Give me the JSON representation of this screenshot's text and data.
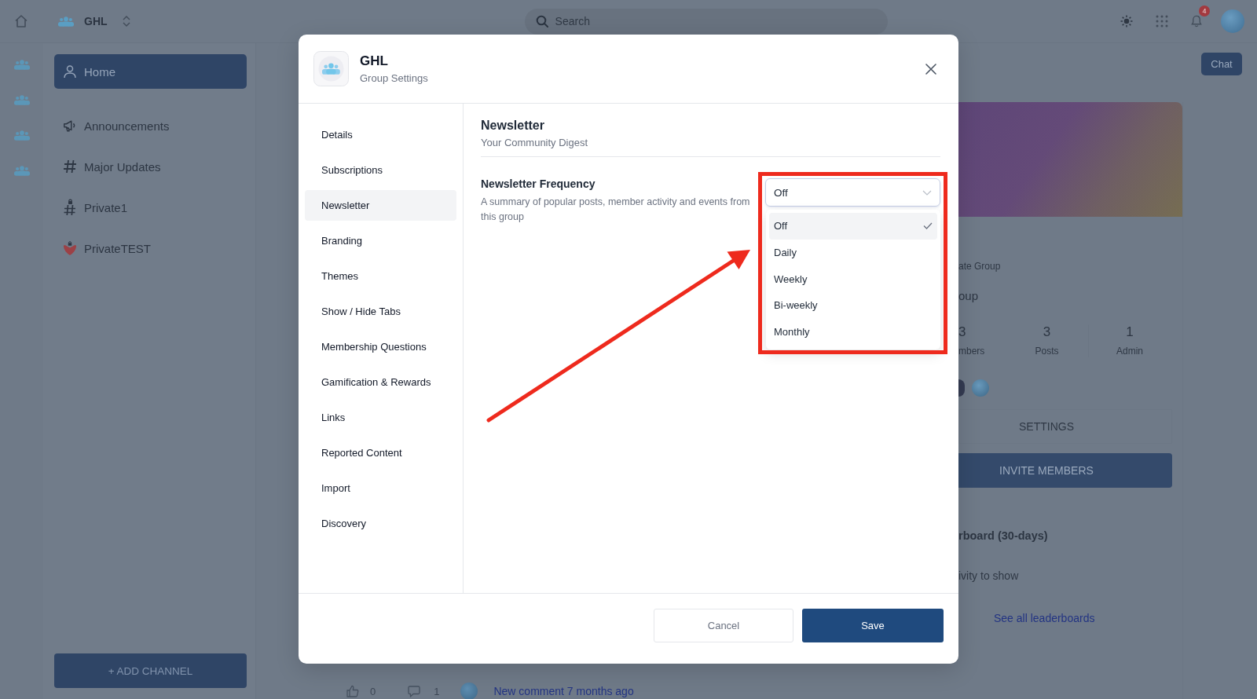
{
  "top_bar": {
    "group_name": "GHL",
    "search": {
      "placeholder": "Search"
    },
    "notification_count": "4"
  },
  "sidebar": {
    "items": [
      {
        "label": "Home",
        "kind": "home",
        "selected": true
      },
      {
        "label": "Announcements",
        "kind": "announcement",
        "selected": false
      },
      {
        "label": "Major Updates",
        "kind": "channel",
        "selected": false
      },
      {
        "label": "Private1",
        "kind": "private_channel",
        "selected": false
      },
      {
        "label": "PrivateTEST",
        "kind": "private_emoji",
        "selected": false
      }
    ],
    "add_button": "+ ADD CHANNEL"
  },
  "modal": {
    "title": "GHL",
    "subtitle": "Group Settings",
    "nav": [
      {
        "label": "Details",
        "selected": false
      },
      {
        "label": "Subscriptions",
        "selected": false
      },
      {
        "label": "Newsletter",
        "selected": true
      },
      {
        "label": "Branding",
        "selected": false
      },
      {
        "label": "Themes",
        "selected": false
      },
      {
        "label": "Show / Hide Tabs",
        "selected": false
      },
      {
        "label": "Membership Questions",
        "selected": false
      },
      {
        "label": "Gamification & Rewards",
        "selected": false
      },
      {
        "label": "Links",
        "selected": false
      },
      {
        "label": "Reported Content",
        "selected": false
      },
      {
        "label": "Import",
        "selected": false
      },
      {
        "label": "Discovery",
        "selected": false
      }
    ],
    "section": {
      "title": "Newsletter",
      "subtitle": "Your Community Digest"
    },
    "setting": {
      "label": "Newsletter Frequency",
      "description": "A summary of popular posts, member activity and events from this group",
      "select": {
        "value": "Off",
        "expanded": true,
        "options": [
          {
            "label": "Off",
            "selected": true
          },
          {
            "label": "Daily",
            "selected": false
          },
          {
            "label": "Weekly",
            "selected": false
          },
          {
            "label": "Bi-weekly",
            "selected": false
          },
          {
            "label": "Monthly",
            "selected": false
          }
        ]
      }
    },
    "buttons": [
      {
        "label": "Cancel",
        "kind": "secondary"
      },
      {
        "label": "Save",
        "kind": "primary"
      }
    ]
  },
  "right_panel": {
    "chat_button": "Chat",
    "group_type": "ate Group",
    "group_name": "oup",
    "stats": [
      {
        "value": "3",
        "label": "mbers"
      },
      {
        "value": "3",
        "label": "Posts"
      },
      {
        "value": "1",
        "label": "Admin"
      }
    ],
    "settings_button": "SETTINGS",
    "invite_button": "INVITE MEMBERS",
    "leaderboard": {
      "title": "rboard (30-days)",
      "empty_text": "ivity to show",
      "link": "See all leaderboards"
    }
  },
  "feed": {
    "likes": "0",
    "comments": "1",
    "activity_link": "New comment 7 months ago"
  }
}
